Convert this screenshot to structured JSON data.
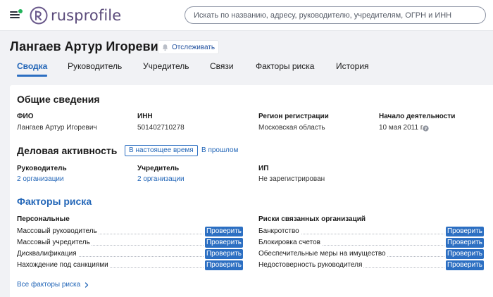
{
  "header": {
    "logo_text": "rusprofile",
    "search_placeholder": "Искать по названию, адресу, руководителю, учредителям, ОГРН и ИНН"
  },
  "person": {
    "name": "Лангаев Артур Игоревич",
    "follow_label": "Отслеживать"
  },
  "tabs": [
    {
      "label": "Сводка",
      "active": true
    },
    {
      "label": "Руководитель",
      "active": false
    },
    {
      "label": "Учредитель",
      "active": false
    },
    {
      "label": "Связи",
      "active": false
    },
    {
      "label": "Факторы риска",
      "active": false
    },
    {
      "label": "История",
      "active": false
    }
  ],
  "general": {
    "title": "Общие сведения",
    "fio_label": "ФИО",
    "fio_value": "Лангаев Артур Игоревич",
    "inn_label": "ИНН",
    "inn_value": "501402710278",
    "region_label": "Регион регистрации",
    "region_value": "Московская область",
    "start_label": "Начало деятельности",
    "start_value": "10 мая 2011 г."
  },
  "activity": {
    "title": "Деловая активность",
    "now_label": "В настоящее время",
    "past_label": "В прошлом",
    "director_label": "Руководитель",
    "director_value": "2 организации",
    "founder_label": "Учредитель",
    "founder_value": "2 организации",
    "ip_label": "ИП",
    "ip_value": "Не зарегистрирован"
  },
  "risks": {
    "title": "Факторы риска",
    "personal_title": "Персональные",
    "related_title": "Риски связанных организаций",
    "check_label": "Проверить",
    "personal": [
      "Массовый руководитель",
      "Массовый учредитель",
      "Дисквалификация",
      "Нахождение под санкциями"
    ],
    "related": [
      "Банкротство",
      "Блокировка счетов",
      "Обеспечительные меры на имущество",
      "Недостоверность руководителя"
    ],
    "all_link": "Все факторы риска"
  },
  "colors": {
    "accent": "#2c6fc2",
    "link": "#2467b8",
    "logo": "#5a4a7a",
    "notify_dot": "#21b35a"
  }
}
